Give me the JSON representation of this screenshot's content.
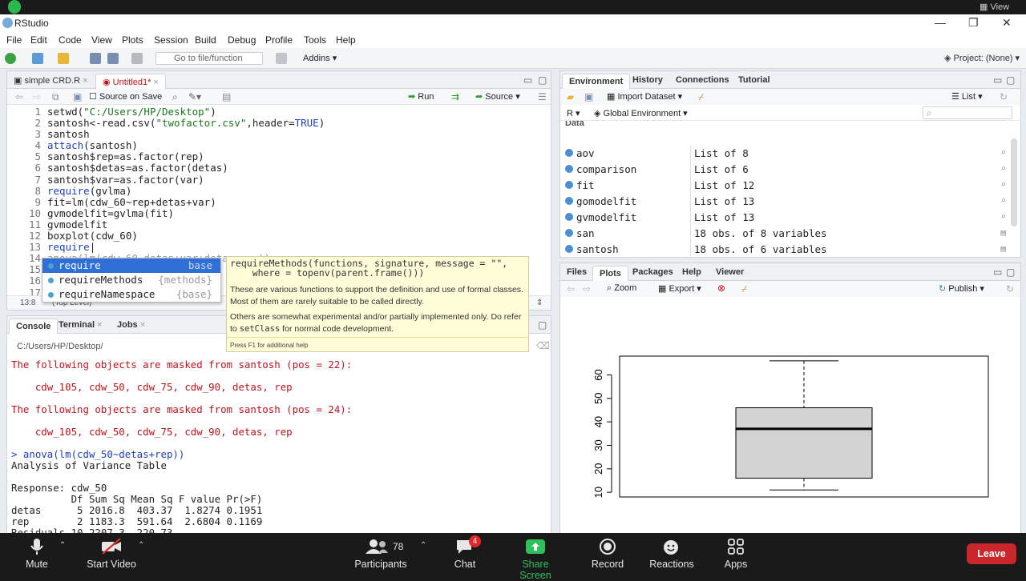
{
  "window": {
    "title": "RStudio",
    "view_label": "View",
    "menu": [
      "File",
      "Edit",
      "Code",
      "View",
      "Plots",
      "Session",
      "Build",
      "Debug",
      "Profile",
      "Tools",
      "Help"
    ],
    "goto_placeholder": "Go to file/function",
    "addins": "Addins",
    "project": "Project: (None)"
  },
  "editor": {
    "tabs": [
      "simple CRD.R",
      "Untitled1*"
    ],
    "source_on_save": "Source on Save",
    "run": "Run",
    "source": "Source",
    "line_numbers": [
      "1",
      "2",
      "3",
      "4",
      "5",
      "6",
      "7",
      "8",
      "9",
      "10",
      "11",
      "12",
      "13",
      "14",
      "15",
      "16",
      "17"
    ],
    "cursor_pos": "13:8",
    "scope": "(Top Level)",
    "script": "R Script"
  },
  "autocomplete": {
    "items": [
      {
        "name": "require",
        "pkg": "base"
      },
      {
        "name": "requireMethods",
        "pkg": "{methods}"
      },
      {
        "name": "requireNamespace",
        "pkg": "{base}"
      }
    ]
  },
  "help_tip": {
    "signature": "requireMethods(functions, signature, message = \"\",\n    where = topenv(parent.frame()))",
    "desc1": "These are various functions to support the definition and use of formal classes. Most of them are rarely suitable to be called directly.",
    "desc2a": "Others are somewhat experimental and/or partially implemented only. Do refer to ",
    "desc2code": "setClass",
    "desc2b": " for normal code development.",
    "footer": "Press F1 for additional help"
  },
  "console": {
    "tabs": [
      "Console",
      "Terminal",
      "Jobs"
    ],
    "path": "C:/Users/HP/Desktop/",
    "mask1": "The following objects are masked from santosh (pos = 22):",
    "mask1_vars": "    cdw_105, cdw_50, cdw_75, cdw_90, detas, rep",
    "mask2": "The following objects are masked from santosh (pos = 24):",
    "mask2_vars": "    cdw_105, cdw_50, cdw_75, cdw_90, detas, rep",
    "cmd": "> anova(lm(cdw_50~detas+rep))",
    "out1": "Analysis of Variance Table",
    "out2": "Response: cdw_50",
    "out3": "          Df Sum Sq Mean Sq F value Pr(>F)",
    "out4": "detas      5 2016.8  403.37  1.8274 0.1951",
    "out5": "rep        2 1183.3  591.64  2.6804 0.1169",
    "out6": "Residuals 10 2207.3  220.73"
  },
  "environment": {
    "tabs": [
      "Environment",
      "History",
      "Connections",
      "Tutorial"
    ],
    "import_dataset": "Import Dataset",
    "list_view": "List",
    "lang": "R",
    "scope": "Global Environment",
    "section": "Data",
    "rows": [
      {
        "name": "aov",
        "value": "List of  8"
      },
      {
        "name": "comparison",
        "value": "List of  6"
      },
      {
        "name": "fit",
        "value": "List of  12"
      },
      {
        "name": "gomodelfit",
        "value": "List of  13"
      },
      {
        "name": "gvmodelfit",
        "value": "List of  13"
      },
      {
        "name": "san",
        "value": "18 obs. of 8 variables"
      },
      {
        "name": "santosh",
        "value": "18 obs. of 6 variables"
      }
    ]
  },
  "plots": {
    "tabs": [
      "Files",
      "Plots",
      "Packages",
      "Help",
      "Viewer"
    ],
    "zoom": "Zoom",
    "export": "Export",
    "publish": "Publish"
  },
  "chart_data": {
    "type": "box",
    "title": "",
    "xlabel": "",
    "ylabel": "",
    "ylim": [
      8,
      68
    ],
    "yticks": [
      "10",
      "20",
      "30",
      "40",
      "50",
      "60"
    ],
    "box": {
      "min": 11,
      "q1": 16,
      "median": 37,
      "q3": 46,
      "max": 66
    }
  },
  "zoom": {
    "mute": "Mute",
    "start_video": "Start Video",
    "participants": "Participants",
    "participant_count": "78",
    "chat": "Chat",
    "chat_badge": "4",
    "share": "Share Screen",
    "record": "Record",
    "reactions": "Reactions",
    "apps": "Apps",
    "leave": "Leave"
  }
}
